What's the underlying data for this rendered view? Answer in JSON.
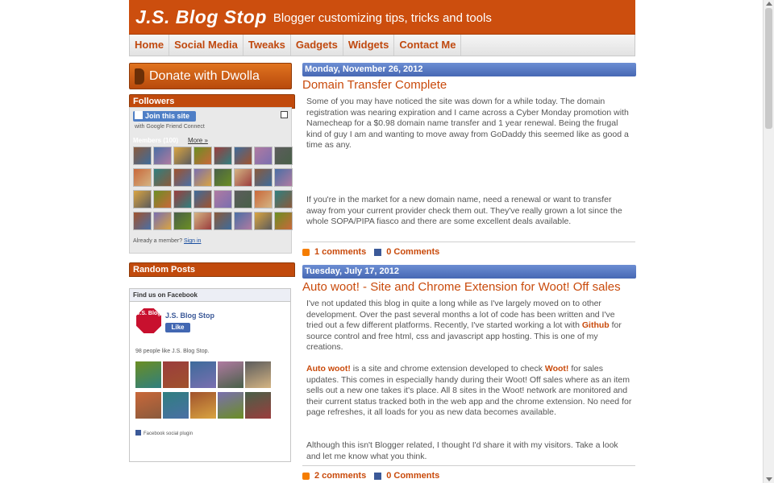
{
  "header": {
    "title": "J.S. Blog Stop",
    "description": "Blogger customizing tips, tricks and tools"
  },
  "nav": {
    "items": [
      {
        "label": "Home"
      },
      {
        "label": "Social Media"
      },
      {
        "label": "Tweaks"
      },
      {
        "label": "Gadgets"
      },
      {
        "label": "Widgets"
      },
      {
        "label": "Contact Me"
      }
    ]
  },
  "sidebar": {
    "donate_label": "Donate with Dwolla",
    "followers": {
      "title": "Followers",
      "join_label": "Join this site",
      "sub_label": "with Google Friend Connect",
      "members_label": "Members (100)",
      "more_label": "More »",
      "already_text": "Already a member?",
      "sign_in_label": "Sign in"
    },
    "random_posts_title": "Random Posts",
    "facebook": {
      "header": "Find us on Facebook",
      "logo_text": "J.S. Blog",
      "page_name": "J.S. Blog Stop",
      "like_label": "Like",
      "people_text": "98 people like J.S. Blog Stop.",
      "footer_text": "Facebook social plugin"
    }
  },
  "posts": [
    {
      "date": "Monday, November 26, 2012",
      "title": "Domain Transfer Complete",
      "paragraph1": "Some of you may have noticed the site was down for a while today. The domain registration was nearing expiration and I came across a Cyber Monday promotion with Namecheap for a $0.98 domain name transfer and 1 year renewal. Being the frugal kind of guy I am and wanting to move away from GoDaddy this seemed like as good a time as any.",
      "paragraph2": "If you're in the market for a new domain name, need a renewal or want to transfer away from your current provider check them out. They've really grown a lot since the whole SOPA/PIPA fiasco and there are some excellent deals available.",
      "comments_label": "1 comments",
      "fb_comments_label": "0 Comments"
    },
    {
      "date": "Tuesday, July 17, 2012",
      "title": "Auto woot! - Site and Chrome Extension for Woot! Off sales",
      "p1_pre": "I've not updated this blog in quite a long while as I've largely moved on to other development. Over the past several months a lot of code has been written and I've tried out a few different platforms. Recently, I've started working a lot with ",
      "p1_link": "Github",
      "p1_post": " for source control and free html, css and javascript app hosting. This is one of my creations.",
      "p2_link1": "Auto woot!",
      "p2_mid": " is a site and chrome extension developed to check ",
      "p2_link2": "Woot!",
      "p2_post": " for sales updates. This comes in especially handy during their Woot! Off sales where as an item sells out a new one takes it's place. All 8 sites in the Woot! network are monitored and their current status tracked both in the web app and the chrome extension. No need for page refreshes, it all loads for you as new data becomes available.",
      "p3": "Although this isn't Blogger related, I thought I'd share it with my visitors. Take a look and let me know what you think.",
      "comments_label": "2 comments",
      "fb_comments_label": "0 Comments"
    }
  ],
  "colors": {
    "accent": "#cc4e0e",
    "date_bar": "#4f72bb",
    "link": "#c94a0b"
  }
}
